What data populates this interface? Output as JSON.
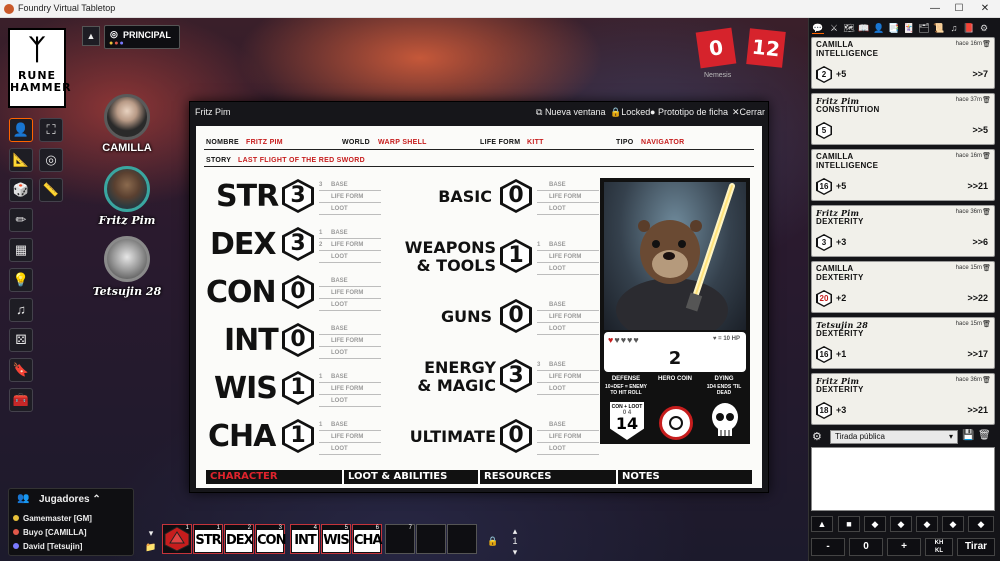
{
  "window": {
    "title": "Foundry Virtual Tabletop",
    "minimize": "—",
    "maximize": "☐",
    "close": "✕"
  },
  "logo": {
    "mark": "ᛉ",
    "line1": "RUNE",
    "line2": "HAMMER"
  },
  "scene": {
    "toggle": "▲",
    "name": "PRINCIPAL",
    "icon": "◎"
  },
  "tools": [
    {
      "name": "token",
      "icon": "👤"
    },
    {
      "name": "fullscreen",
      "icon": "⛶"
    },
    {
      "name": "measure",
      "icon": "📐"
    },
    {
      "name": "target",
      "icon": "◎"
    },
    {
      "name": "tiles",
      "icon": "🎲"
    },
    {
      "name": "ruler",
      "icon": "📏"
    },
    {
      "name": "draw",
      "icon": "✏"
    },
    {
      "name": "walls",
      "icon": "▦"
    },
    {
      "name": "lighting",
      "icon": "💡"
    },
    {
      "name": "sounds",
      "icon": "♫"
    },
    {
      "name": "regions",
      "icon": "⚄"
    },
    {
      "name": "notes",
      "icon": "🔖"
    },
    {
      "name": "toolbox",
      "icon": "🧰"
    }
  ],
  "tokens": [
    {
      "name": "CAMILLA"
    },
    {
      "name": "Fritz Pim"
    },
    {
      "name": "Tetsujin 28"
    }
  ],
  "counters": {
    "left": "0",
    "right": "12",
    "label": "Nemesis"
  },
  "sheet": {
    "title": "Fritz Pim",
    "buttons": {
      "new_window": "Nueva ventana",
      "locked": "Locked",
      "prototype": "Prototipo de ficha",
      "close": "Cerrar"
    },
    "fields": {
      "nombre_label": "NOMBRE",
      "nombre": "FRITZ PIM",
      "world_label": "WORLD",
      "world": "WARP SHELL",
      "lifeform_label": "LIFE FORM",
      "lifeform": "KITT",
      "tipo_label": "TIPO",
      "tipo": "NAVIGATOR",
      "story_label": "STORY",
      "story": "LAST FLIGHT OF THE RED SWORD"
    },
    "sub_labels": {
      "base": "BASE",
      "lifeform": "LIFE FORM",
      "loot": "LOOT"
    },
    "stats": [
      {
        "name": "STR",
        "value": "3",
        "base": "3",
        "lifeform": "",
        "loot": ""
      },
      {
        "name": "DEX",
        "value": "3",
        "base": "1",
        "lifeform": "2",
        "loot": ""
      },
      {
        "name": "CON",
        "value": "0",
        "base": "",
        "lifeform": "",
        "loot": ""
      },
      {
        "name": "INT",
        "value": "0",
        "base": "",
        "lifeform": "",
        "loot": ""
      },
      {
        "name": "WIS",
        "value": "1",
        "base": "1",
        "lifeform": "",
        "loot": ""
      },
      {
        "name": "CHA",
        "value": "1",
        "base": "1",
        "lifeform": "",
        "loot": ""
      }
    ],
    "skills": [
      {
        "l1": "BASIC",
        "l2": "",
        "value": "0",
        "base": "",
        "lifeform": "",
        "loot": ""
      },
      {
        "l1": "WEAPONS",
        "l2": "& TOOLS",
        "value": "1",
        "base": "1",
        "lifeform": "",
        "loot": ""
      },
      {
        "l1": "GUNS",
        "l2": "",
        "value": "0",
        "base": "",
        "lifeform": "",
        "loot": ""
      },
      {
        "l1": "ENERGY",
        "l2": "& MAGIC",
        "value": "3",
        "base": "3",
        "lifeform": "",
        "loot": ""
      },
      {
        "l1": "ULTIMATE",
        "l2": "",
        "value": "0",
        "base": "",
        "lifeform": "",
        "loot": ""
      }
    ],
    "hp": {
      "hearts": "♥♥♥♥♥",
      "note": "♥ = 10 HP",
      "value": "2"
    },
    "defense": {
      "label": "DEFENSE",
      "note": "10+DEF = ENEMY TO HIT ROLL",
      "sub": "CON + LOOT",
      "con": "0",
      "loot": "4",
      "value": "14"
    },
    "hero_coin": {
      "label": "HERO COIN"
    },
    "dying": {
      "label": "DYING",
      "note": "1D4 ENDS 'TIL DEAD"
    },
    "tabs": [
      "CHARACTER",
      "LOOT & ABILITIES",
      "RESOURCES",
      "NOTES"
    ]
  },
  "players": {
    "title": "Jugadores",
    "list": [
      {
        "name": "Gamemaster [GM]",
        "color": "#e8c13a"
      },
      {
        "name": "Buyo [CAMILLA]",
        "color": "#e0584a"
      },
      {
        "name": "David [Tetsujin]",
        "color": "#7a7aff"
      }
    ]
  },
  "hotbar": {
    "slots": [
      {
        "num": "1",
        "label": "",
        "icon": "d20"
      },
      {
        "num": "1",
        "label": "STR"
      },
      {
        "num": "2",
        "label": "DEX"
      },
      {
        "num": "3",
        "label": "CON"
      },
      {
        "num": "4",
        "label": "INT"
      },
      {
        "num": "5",
        "label": "WIS"
      },
      {
        "num": "6",
        "label": "CHA"
      },
      {
        "num": "7",
        "label": ""
      },
      {
        "num": "",
        "label": ""
      },
      {
        "num": "",
        "label": ""
      }
    ],
    "page": "1",
    "lock": "🔒"
  },
  "sidebar_tabs": [
    "💬",
    "⚔",
    "🗺",
    "📖",
    "👤",
    "📑",
    "🃏",
    "🗂",
    "📜",
    "♫",
    "📕",
    "⚙"
  ],
  "chat": [
    {
      "speaker": "CAMILLA",
      "italic": false,
      "time": "hace 16m",
      "ability": "INTELLIGENCE",
      "die": "2",
      "mod": "+5",
      "total": ">>7",
      "crit": false
    },
    {
      "speaker": "Fritz Pim",
      "italic": true,
      "time": "hace 37m",
      "ability": "CONSTITUTION",
      "die": "5",
      "mod": "",
      "total": ">>5",
      "crit": false
    },
    {
      "speaker": "CAMILLA",
      "italic": false,
      "time": "hace 16m",
      "ability": "INTELLIGENCE",
      "die": "16",
      "mod": "+5",
      "total": ">>21",
      "crit": false
    },
    {
      "speaker": "Fritz Pim",
      "italic": true,
      "time": "hace 36m",
      "ability": "DEXTERITY",
      "die": "3",
      "mod": "+3",
      "total": ">>6",
      "crit": false
    },
    {
      "speaker": "CAMILLA",
      "italic": false,
      "time": "hace 15m",
      "ability": "DEXTERITY",
      "die": "20",
      "mod": "+2",
      "total": ">>22",
      "crit": true
    },
    {
      "speaker": "Tetsujin 28",
      "italic": true,
      "time": "hace 15m",
      "ability": "DEXTERITY",
      "die": "16",
      "mod": "+1",
      "total": ">>17",
      "crit": false
    },
    {
      "speaker": "Fritz Pim",
      "italic": true,
      "time": "hace 36m",
      "ability": "DEXTERITY",
      "die": "18",
      "mod": "+3",
      "total": ">>21",
      "crit": false
    }
  ],
  "roll_mode": "Tirada pública",
  "dice_buttons": [
    "▲",
    "■",
    "◆",
    "◆",
    "◆",
    "◆",
    "◆"
  ],
  "roll_controls": {
    "minus": "-",
    "value": "0",
    "plus": "+",
    "kh": "KH",
    "kl": "KL",
    "roll": "Tirar"
  }
}
